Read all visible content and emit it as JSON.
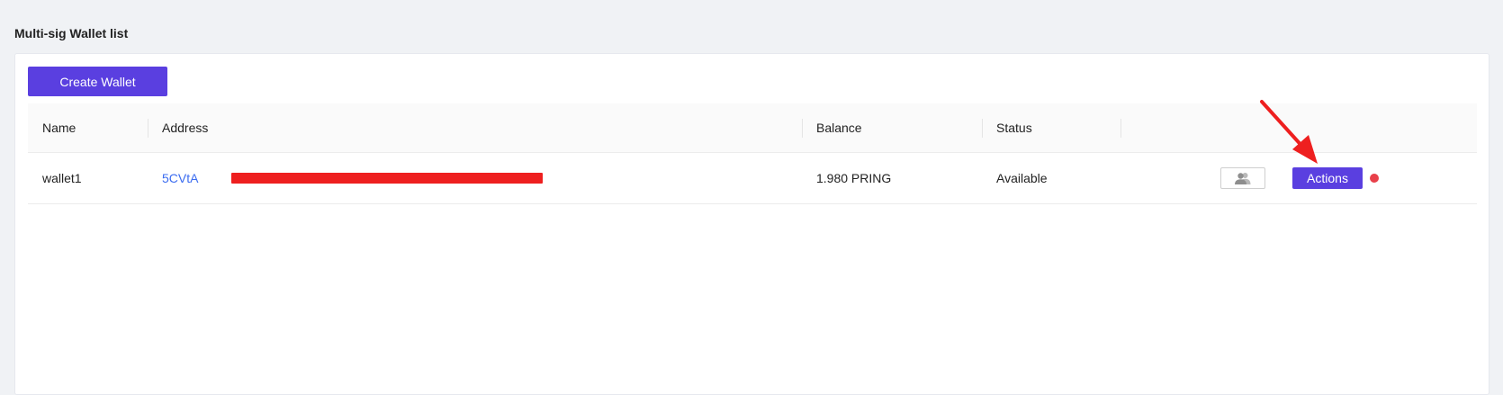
{
  "page": {
    "title": "Multi-sig Wallet list"
  },
  "toolbar": {
    "create_label": "Create Wallet"
  },
  "table": {
    "columns": {
      "name": "Name",
      "address": "Address",
      "balance": "Balance",
      "status": "Status"
    },
    "rows": [
      {
        "name": "wallet1",
        "address_visible": "5CVtA",
        "balance": "1.980 PRING",
        "status": "Available",
        "members_icon": "members-icon",
        "actions_label": "Actions"
      }
    ]
  },
  "colors": {
    "accent": "#5a3fe0",
    "link": "#3b6cf0",
    "annotation": "#ee1f1f",
    "status_dot": "#e8404a"
  }
}
